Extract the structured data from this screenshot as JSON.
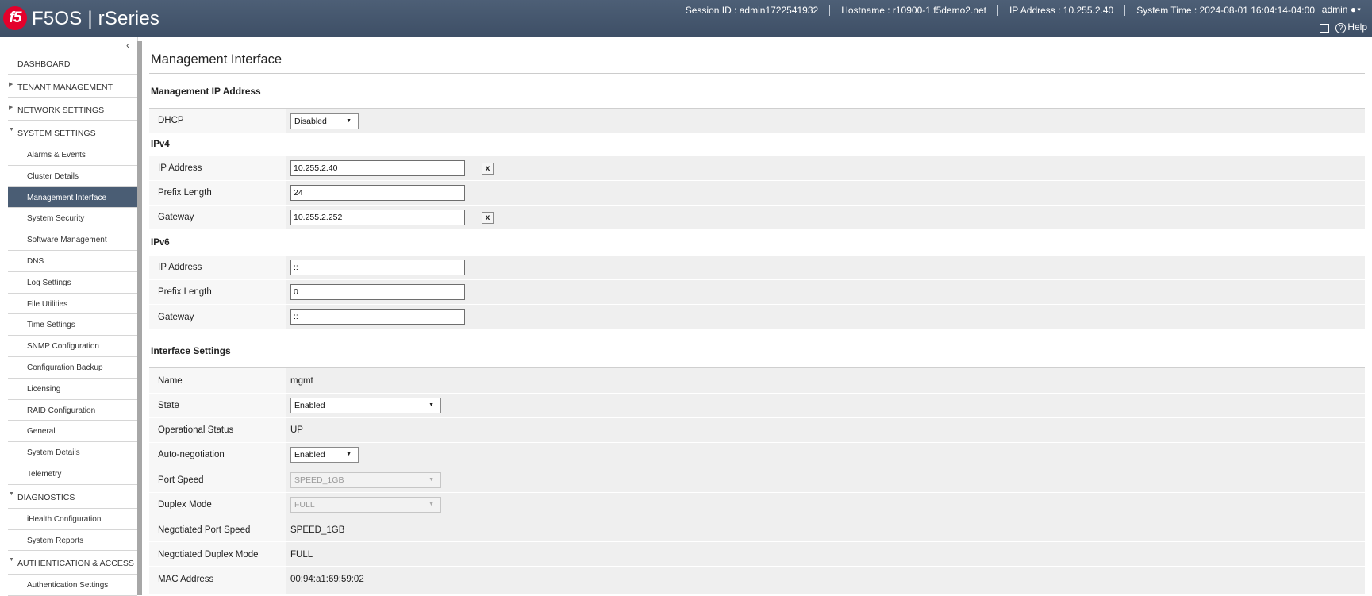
{
  "header": {
    "logo_text": "f5",
    "brand": "F5OS | rSeries",
    "session_id": "Session ID : admin1722541932",
    "hostname": "Hostname : r10900-1.f5demo2.net",
    "ip_address": "IP Address : 10.255.2.40",
    "system_time": "System Time : 2024-08-01 16:04:14-04:00",
    "user": "admin",
    "help_label": "Help"
  },
  "sidebar": {
    "collapse_glyph": "‹",
    "items": [
      {
        "label": "DASHBOARD",
        "level": "top"
      },
      {
        "label": "TENANT MANAGEMENT",
        "level": "top",
        "expanded": false
      },
      {
        "label": "NETWORK SETTINGS",
        "level": "top",
        "expanded": false
      },
      {
        "label": "SYSTEM SETTINGS",
        "level": "top",
        "expanded": true
      },
      {
        "label": "Alarms & Events",
        "level": "sub"
      },
      {
        "label": "Cluster Details",
        "level": "sub"
      },
      {
        "label": "Management Interface",
        "level": "sub",
        "active": true
      },
      {
        "label": "System Security",
        "level": "sub"
      },
      {
        "label": "Software Management",
        "level": "sub"
      },
      {
        "label": "DNS",
        "level": "sub"
      },
      {
        "label": "Log Settings",
        "level": "sub"
      },
      {
        "label": "File Utilities",
        "level": "sub"
      },
      {
        "label": "Time Settings",
        "level": "sub"
      },
      {
        "label": "SNMP Configuration",
        "level": "sub"
      },
      {
        "label": "Configuration Backup",
        "level": "sub"
      },
      {
        "label": "Licensing",
        "level": "sub"
      },
      {
        "label": "RAID Configuration",
        "level": "sub"
      },
      {
        "label": "General",
        "level": "sub"
      },
      {
        "label": "System Details",
        "level": "sub"
      },
      {
        "label": "Telemetry",
        "level": "sub"
      },
      {
        "label": "DIAGNOSTICS",
        "level": "top",
        "expanded": true
      },
      {
        "label": "iHealth Configuration",
        "level": "sub"
      },
      {
        "label": "System Reports",
        "level": "sub"
      },
      {
        "label": "AUTHENTICATION & ACCESS",
        "level": "top",
        "expanded": true
      },
      {
        "label": "Authentication Settings",
        "level": "sub"
      }
    ]
  },
  "main": {
    "title": "Management Interface",
    "mgmt_ip_heading": "Management IP Address",
    "dhcp": {
      "label": "DHCP",
      "value": "Disabled"
    },
    "ipv4": {
      "heading": "IPv4",
      "ip_label": "IP Address",
      "ip_value": "10.255.2.40",
      "prefix_label": "Prefix Length",
      "prefix_value": "24",
      "gateway_label": "Gateway",
      "gateway_value": "10.255.2.252",
      "clear_label": "x"
    },
    "ipv6": {
      "heading": "IPv6",
      "ip_label": "IP Address",
      "ip_value": "::",
      "prefix_label": "Prefix Length",
      "prefix_value": "0",
      "gateway_label": "Gateway",
      "gateway_value": "::"
    },
    "interface": {
      "heading": "Interface Settings",
      "name_label": "Name",
      "name_value": "mgmt",
      "state_label": "State",
      "state_value": "Enabled",
      "opstatus_label": "Operational Status",
      "opstatus_value": "UP",
      "autoneg_label": "Auto-negotiation",
      "autoneg_value": "Enabled",
      "speed_label": "Port Speed",
      "speed_value": "SPEED_1GB",
      "duplex_label": "Duplex Mode",
      "duplex_value": "FULL",
      "neg_speed_label": "Negotiated Port Speed",
      "neg_speed_value": "SPEED_1GB",
      "neg_duplex_label": "Negotiated Duplex Mode",
      "neg_duplex_value": "FULL",
      "mac_label": "MAC Address",
      "mac_value": "00:94:a1:69:59:02"
    }
  },
  "colors": {
    "header_bg": "#45576e",
    "logo_red": "#e4002b",
    "active_nav_bg": "#4a5d74",
    "row_bg": "#efefef"
  }
}
